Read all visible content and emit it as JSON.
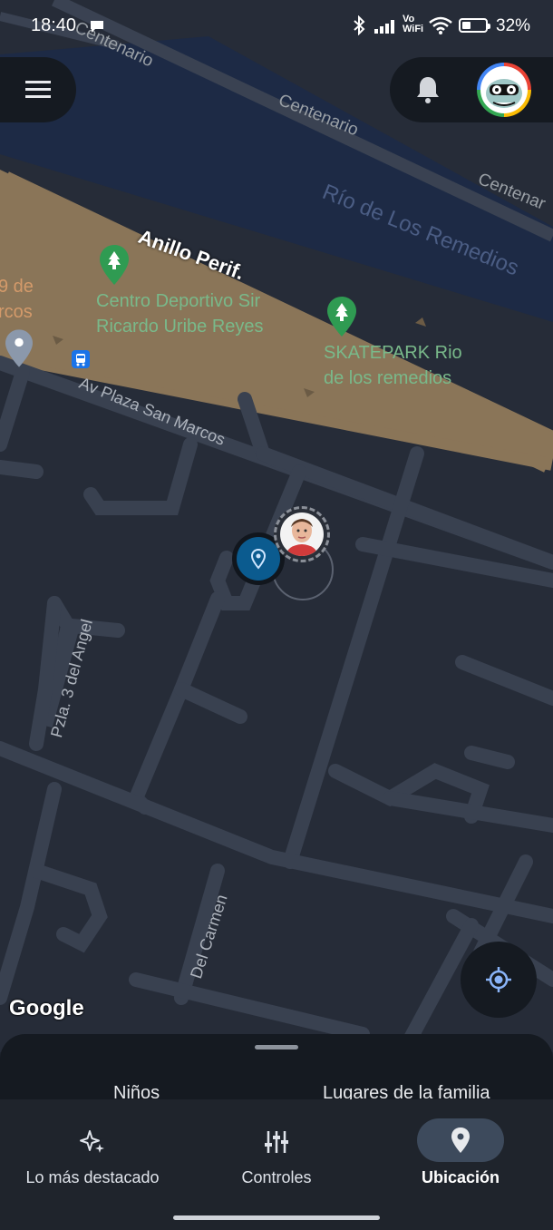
{
  "status_bar": {
    "time": "18:40",
    "network_vo": "Vo",
    "network_wifi": "WiFi",
    "battery": "32%"
  },
  "map": {
    "labels": {
      "centenario_1": "Centenario",
      "centenario_2": "Centenario",
      "centenario_3": "Centenar",
      "river": "Río de Los Remedios",
      "anillo": "Anillo Perif.",
      "park1_line1": "Centro Deportivo Sir",
      "park1_line2": "Ricardo Uribe Reyes",
      "park2_line1": "SKATEPARK Rio",
      "park2_line2": "de los remedios",
      "partial1_line1": "9 de",
      "partial1_line2": "rcos",
      "av_plaza": "Av Plaza San Marcos",
      "pzla": "Pzla. 3 del Angel",
      "del_carmen": "Del Carmen"
    },
    "attribution": "Google",
    "colors": {
      "background": "#262c38",
      "river": "#1d2a45",
      "highway": "#8a7558",
      "road": "#394150",
      "park_label": "#79b98a",
      "accent": "#0b5b8f"
    }
  },
  "header": {
    "menu_icon": "menu-icon",
    "notification_icon": "bell-icon"
  },
  "bottom_sheet": {
    "tab_children": "Niños",
    "tab_places": "Lugares de la familia"
  },
  "bottom_nav": {
    "items": [
      {
        "label": "Lo más destacado",
        "icon": "sparkle-icon"
      },
      {
        "label": "Controles",
        "icon": "sliders-icon"
      },
      {
        "label": "Ubicación",
        "icon": "location-pin-icon",
        "selected": true
      }
    ]
  }
}
